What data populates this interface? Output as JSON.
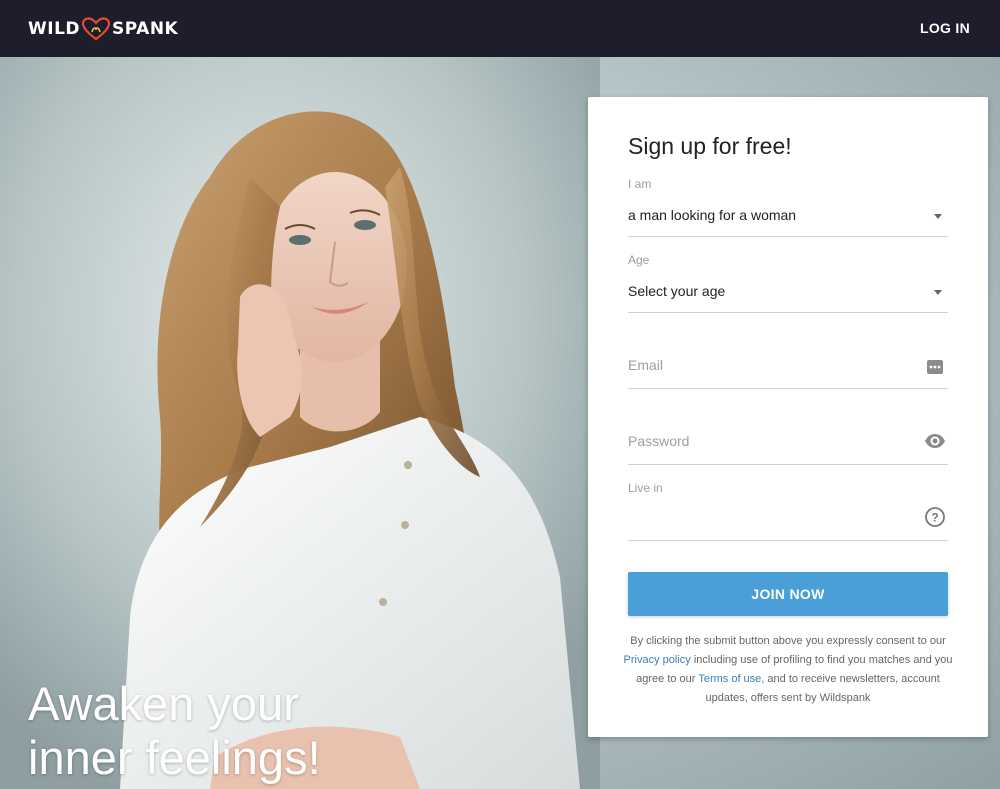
{
  "header": {
    "logo_left": "WILD",
    "logo_right": "SPANK",
    "login_label": "LOG IN"
  },
  "hero": {
    "headline_line1": "Awaken your",
    "headline_line2": "inner feelings!"
  },
  "signup": {
    "title": "Sign up for free!",
    "i_am": {
      "label": "I am",
      "value": "a man looking for a woman"
    },
    "age": {
      "label": "Age",
      "value": "Select your age"
    },
    "email": {
      "placeholder": "Email"
    },
    "password": {
      "placeholder": "Password"
    },
    "live_in": {
      "label": "Live in",
      "value": ""
    },
    "join_label": "JOIN NOW",
    "legal": {
      "part1": "By clicking the submit button above you expressly consent to our ",
      "privacy_link": "Privacy policy",
      "part2": " including use of profiling to find you matches and you agree to our ",
      "terms_link": "Terms of use",
      "part3": ", and to receive newsletters, account updates, offers sent by Wildspank"
    }
  },
  "colors": {
    "header_bg": "#1d1d2b",
    "accent": "#4a9fd8",
    "link": "#3a7fb8"
  },
  "icons": [
    "heart-logo-icon",
    "dropdown-caret-icon",
    "password-manager-icon",
    "eye-icon",
    "help-icon"
  ]
}
